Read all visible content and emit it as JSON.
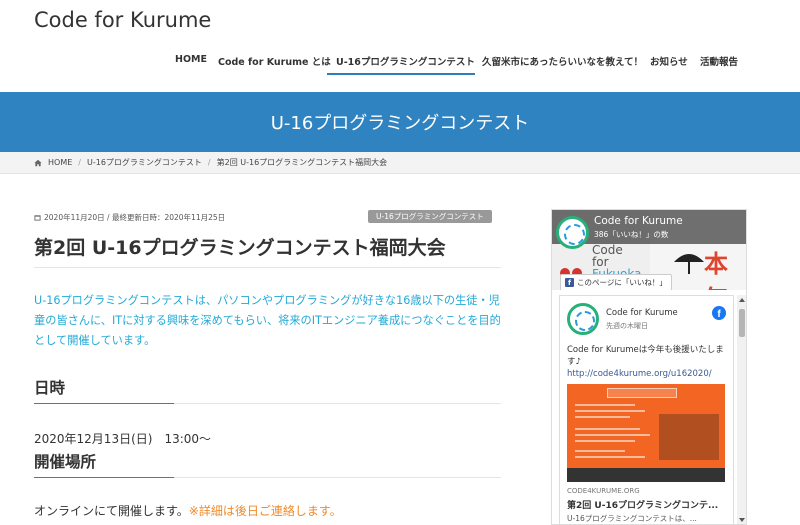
{
  "site": {
    "title": "Code for Kurume"
  },
  "nav": {
    "items": [
      {
        "label": "HOME"
      },
      {
        "label": "Code for Kurume とは"
      },
      {
        "label": "U-16プログラミングコンテスト"
      },
      {
        "label": "久留米市にあったらいいなを教えて！"
      },
      {
        "label": "お知らせ"
      },
      {
        "label": "活動報告"
      }
    ],
    "active_index": 2
  },
  "hero": {
    "title": "U-16プログラミングコンテスト"
  },
  "breadcrumb": {
    "items": [
      {
        "label": "HOME",
        "icon": "home-icon"
      },
      {
        "label": "U-16プログラミングコンテスト"
      },
      {
        "label": "第2回 U-16プログラミングコンテスト福岡大会"
      }
    ],
    "separator": "/"
  },
  "post": {
    "meta": "2020年11月20日 / 最終更新日時：2020年11月25日",
    "category": "U-16プログラミングコンテスト",
    "title": "第2回 U-16プログラミングコンテスト福岡大会",
    "intro": "U-16プログラミングコンテストは、パソコンやプログラミングが好きな16歳以下の生徒・児童の皆さんに、ITに対する興味を深めてもらい、将来のITエンジニア養成につなぐことを目的として開催しています。",
    "sections": [
      {
        "heading": "日時",
        "body": "2020年12月13日(日)　13:00～"
      },
      {
        "heading": "開催場所",
        "body": "オンラインにて開催します。",
        "note": "※詳細は後日ご連絡します。"
      }
    ],
    "colors": {
      "intro": "#22a9d6",
      "note": "#f08a2a",
      "accent": "#2f83c1"
    }
  },
  "facebook": {
    "page_name": "Code for Kurume",
    "likes": "386「いいね！」の数",
    "cover_text": [
      "Code",
      "for",
      "Fukuoka"
    ],
    "cover_kanji": "本気",
    "like_button": "このページに「いいね！」",
    "post": {
      "author": "Code for Kurume",
      "date": "先週の木曜日",
      "text": "Code for Kurumeは今年も後援いたします♪",
      "link": "http://code4kurume.org/u162020/",
      "domain": "CODE4KURUME.ORG",
      "card_title": "第2回 U-16プログラミングコンテ...",
      "card_desc": "U-16プログラミングコンテストは、..."
    }
  }
}
